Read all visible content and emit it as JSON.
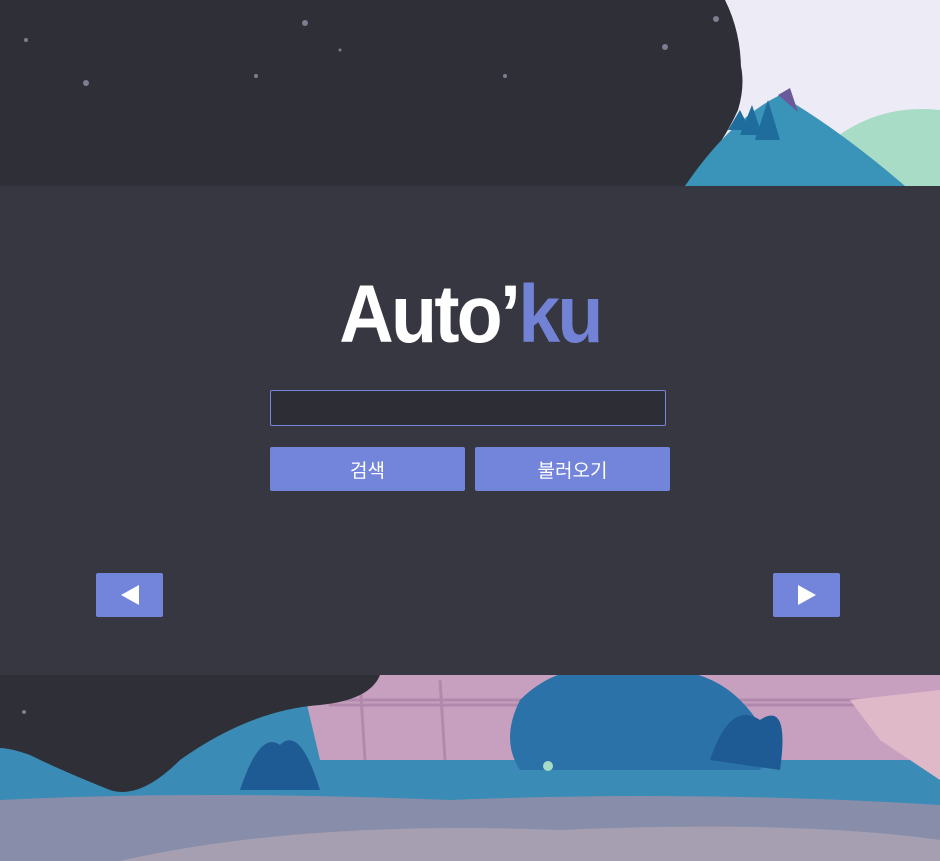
{
  "logo": {
    "part1": "Auto’",
    "part2": "ku"
  },
  "search": {
    "value": "",
    "placeholder": ""
  },
  "buttons": {
    "search_label": "검색",
    "load_label": "불러오기"
  },
  "nav": {
    "prev_icon": "triangle-left-icon",
    "next_icon": "triangle-right-icon"
  },
  "colors": {
    "accent": "#7385db",
    "panel": "#363740",
    "background_dark": "#2f3037",
    "logo_text": "#ffffff",
    "logo_accent": "#7283d6"
  }
}
